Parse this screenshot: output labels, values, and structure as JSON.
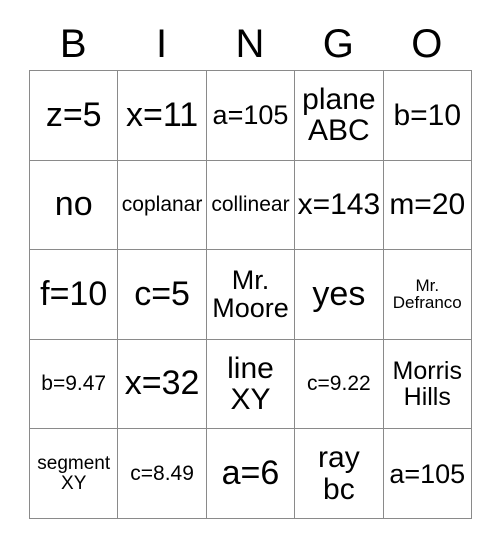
{
  "card": {
    "columns": [
      "B",
      "I",
      "N",
      "G",
      "O"
    ],
    "rows": [
      [
        {
          "text": "z=5",
          "size": "fs-xl"
        },
        {
          "text": "x=11",
          "size": "fs-xl"
        },
        {
          "text": "a=105",
          "size": "fs-md"
        },
        {
          "text": "plane\nABC",
          "size": "fs-lg"
        },
        {
          "text": "b=10",
          "size": "fs-lg"
        }
      ],
      [
        {
          "text": "no",
          "size": "fs-xl"
        },
        {
          "text": "coplanar",
          "size": "fs-xs"
        },
        {
          "text": "collinear",
          "size": "fs-xs"
        },
        {
          "text": "x=143",
          "size": "fs-lg"
        },
        {
          "text": "m=20",
          "size": "fs-lg"
        }
      ],
      [
        {
          "text": "f=10",
          "size": "fs-xl"
        },
        {
          "text": "c=5",
          "size": "fs-xl"
        },
        {
          "text": "Mr.\nMoore",
          "size": "fs-md"
        },
        {
          "text": "yes",
          "size": "fs-xl"
        },
        {
          "text": "Mr.\nDefranco",
          "size": "fs-tiny"
        }
      ],
      [
        {
          "text": "b=9.47",
          "size": "fs-xs"
        },
        {
          "text": "x=32",
          "size": "fs-xl"
        },
        {
          "text": "line\nXY",
          "size": "fs-lg"
        },
        {
          "text": "c=9.22",
          "size": "fs-xs"
        },
        {
          "text": "Morris\nHills",
          "size": "fs-sm"
        }
      ],
      [
        {
          "text": "segment\nXY",
          "size": "fs-xxs"
        },
        {
          "text": "c=8.49",
          "size": "fs-xs"
        },
        {
          "text": "a=6",
          "size": "fs-xl"
        },
        {
          "text": "ray\nbc",
          "size": "fs-lg"
        },
        {
          "text": "a=105",
          "size": "fs-md"
        }
      ]
    ]
  },
  "colors": {
    "grid_line": "#8a8a8a",
    "text": "#000000",
    "background": "#ffffff"
  }
}
